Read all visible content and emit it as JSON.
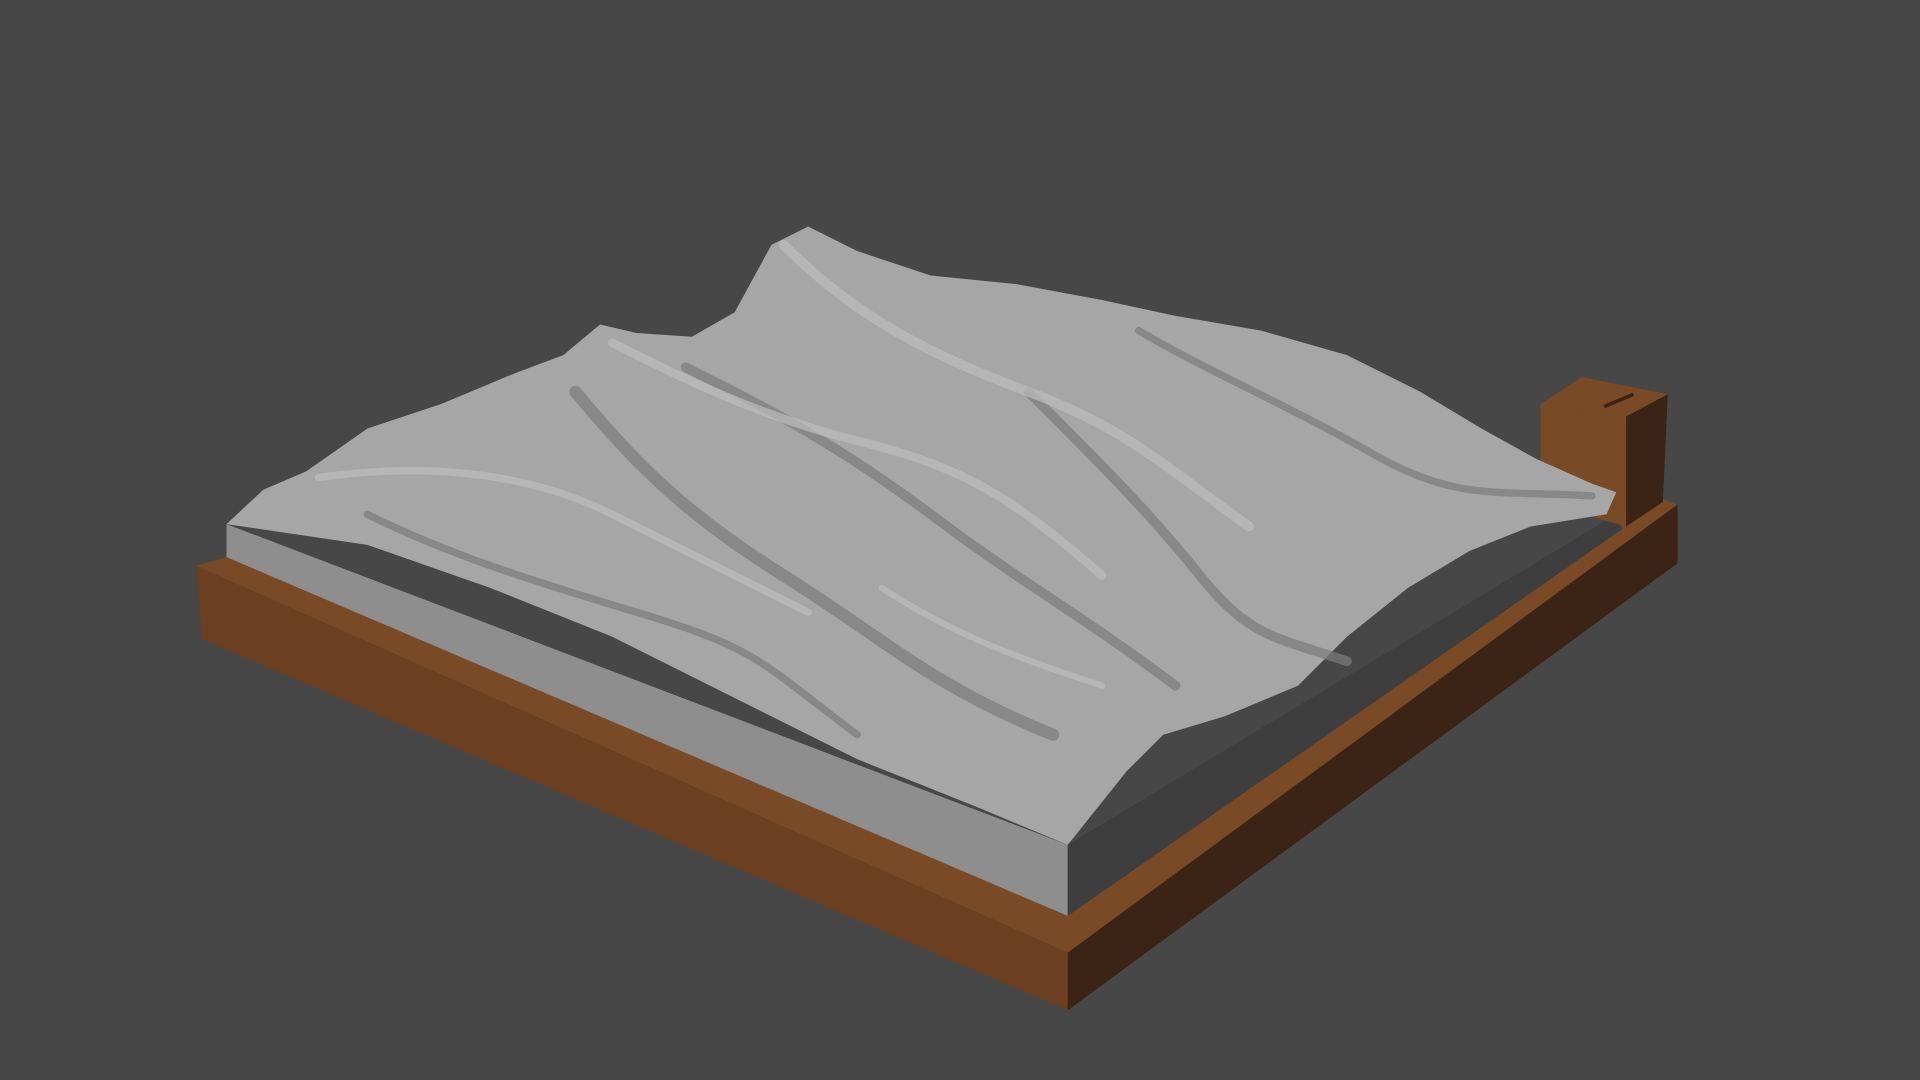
{
  "scene": {
    "subject": "terrain-relief-model",
    "colors": {
      "background": "#474747",
      "base_top": "#7a4a26",
      "base_front": "#6b3f20",
      "base_side": "#3b2416",
      "slab_front": "#8e8e8e",
      "slab_side": "#3e3e3e",
      "terrain": "#a6a6a6",
      "terrain_shadow": "#7c7c7c",
      "terrain_highlight": "#bdbdbd"
    }
  }
}
